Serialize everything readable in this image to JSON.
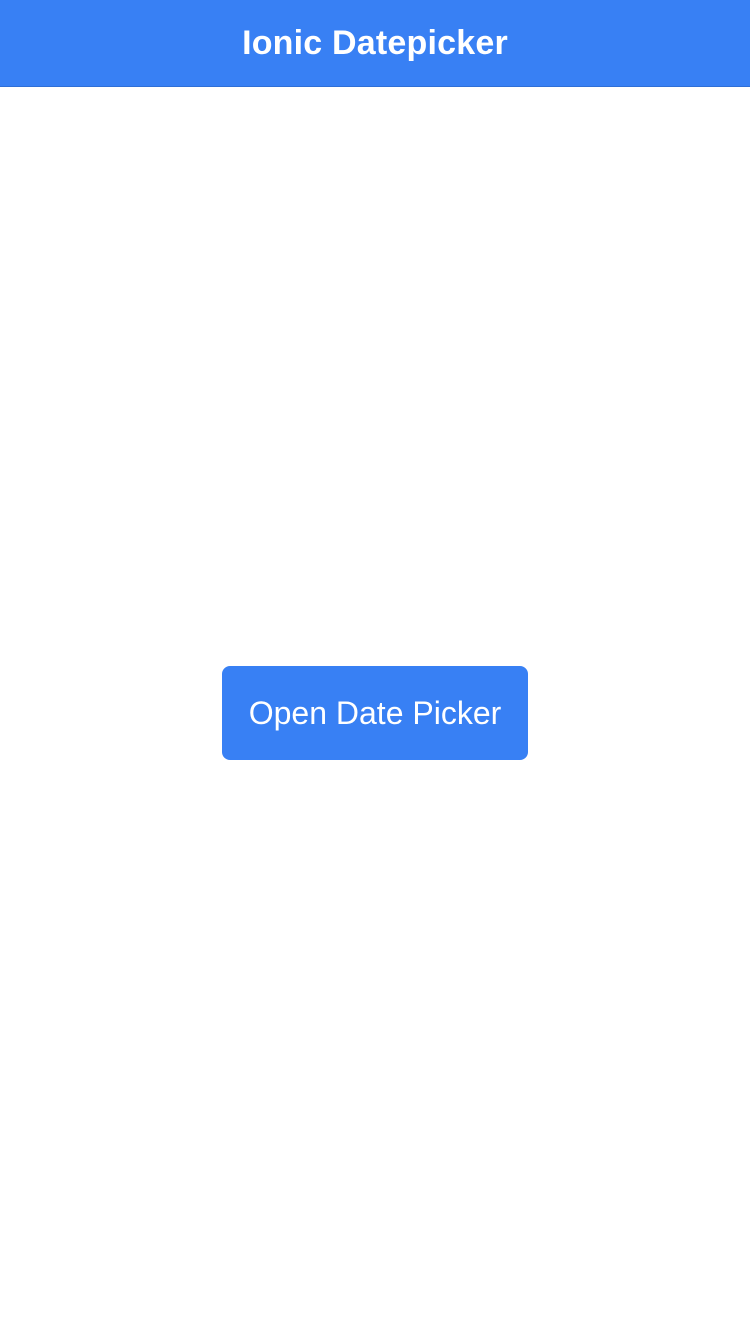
{
  "header": {
    "title": "Ionic Datepicker"
  },
  "main": {
    "open_button_label": "Open Date Picker"
  },
  "colors": {
    "primary": "#3880f4",
    "background": "#ffffff",
    "text_on_primary": "#ffffff"
  }
}
